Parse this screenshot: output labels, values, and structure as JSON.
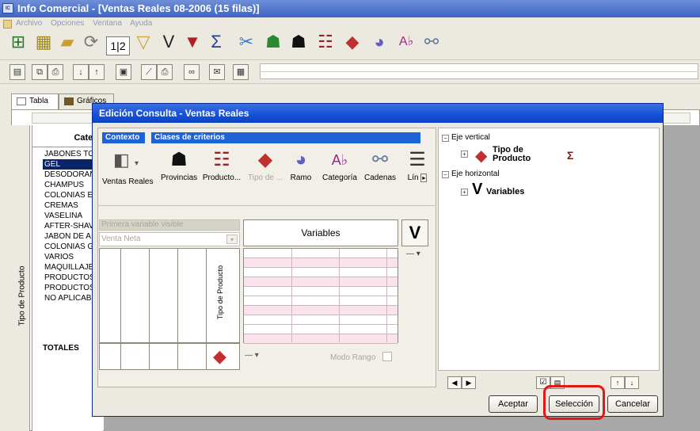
{
  "window": {
    "title": "Info Comercial - [Ventas Reales 08-2006 (15 filas)]"
  },
  "menu": [
    "Archivo",
    "Opciones",
    "Ventana",
    "Ayuda"
  ],
  "toolbar1_icons": [
    "new-query-icon",
    "open-folder-icon",
    "folder-open-icon",
    "refresh-icon",
    "numbers-icon",
    "filter-icon",
    "variables-icon",
    "filter-red-icon",
    "sum-icon",
    "link-icon",
    "context-icon",
    "map-spain-icon",
    "hierarchy-icon",
    "pyramid-icon",
    "pie-icon",
    "abc-icon",
    "chain-icon"
  ],
  "toolbar2_icons": [
    "doc-icon",
    "copy-icon",
    "print-icon",
    "sort-asc-icon",
    "sort-desc-icon",
    "save-icon",
    "chart-icon",
    "print2-icon",
    "binoculars-icon",
    "mail-icon",
    "calc-icon"
  ],
  "tabs": {
    "tabla": "Tabla",
    "graficos": "Gráficos"
  },
  "background": {
    "column_header": "Categ",
    "row_dimension_label": "Tipo de Producto",
    "rows": [
      "JABONES TO",
      "GEL",
      "DESODORAN",
      "CHAMPUS",
      "COLONIAS E",
      "CREMAS",
      "VASELINA",
      "AFTER-SHAV",
      "JABON DE A",
      "COLONIAS G",
      "VARIOS",
      "MAQUILLAJE",
      "PRODUCTOS",
      "PRODUCTOS",
      "NO APLICAB"
    ],
    "selected_row": "GEL",
    "totals": "TOTALES"
  },
  "dialog": {
    "title": "Edición Consulta - Ventas Reales",
    "context_header": "Contexto",
    "criteria_header": "Clases de criterios",
    "context_item": "Ventas Reales",
    "criteria": [
      {
        "label": "Provincias",
        "icon": "map-spain-icon",
        "enabled": true
      },
      {
        "label": "Producto...",
        "icon": "hierarchy-icon",
        "enabled": true
      },
      {
        "label": "Tipo de ...",
        "icon": "pyramid-icon",
        "enabled": false
      },
      {
        "label": "Ramo",
        "icon": "pie-icon",
        "enabled": true
      },
      {
        "label": "Categoría",
        "icon": "abc-icon",
        "enabled": true
      },
      {
        "label": "Cadenas",
        "icon": "chain-icon",
        "enabled": true
      },
      {
        "label": "Lín",
        "icon": "lines-icon",
        "enabled": true
      }
    ],
    "first_variable_label": "Primera variable visible",
    "first_variable_value": "Venta Neta",
    "variables_header": "Variables",
    "row_axis_label": "Tipo de Producto",
    "modo_rango_label": "Modo Rango",
    "tree": {
      "vertical_axis": "Eje vertical",
      "vertical_item": "Tipo de Producto",
      "horizontal_axis": "Eje horizontal",
      "horizontal_item": "Variables"
    },
    "buttons": {
      "accept": "Aceptar",
      "selection": "Selección",
      "cancel": "Cancelar"
    }
  }
}
